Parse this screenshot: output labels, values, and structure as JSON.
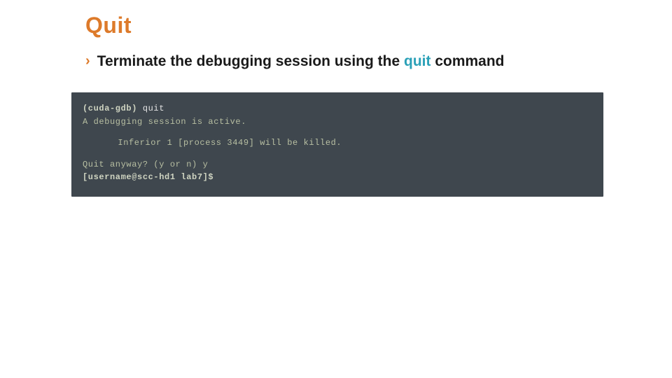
{
  "title": "Quit",
  "chevron": "›",
  "subtitle_pre": "Terminate the debugging session using the ",
  "subtitle_hl": "quit",
  "subtitle_post": " command",
  "code": {
    "l1_prompt": "(cuda-gdb)",
    "l1_cmd": " quit",
    "l2": "A debugging session is active.",
    "l3": "Inferior 1 [process 3449] will be killed.",
    "l4": "Quit anyway? (y or n) y",
    "l5": "[username@scc-hd1 lab7]$"
  }
}
